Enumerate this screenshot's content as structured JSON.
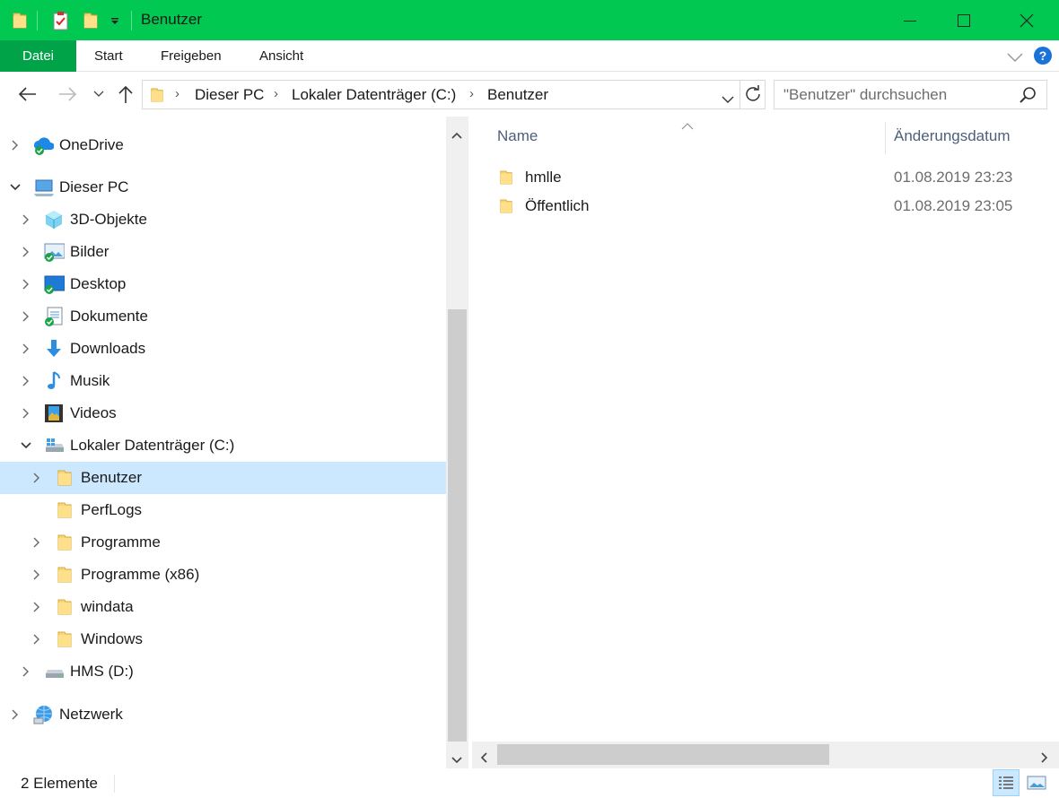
{
  "window": {
    "title": "Benutzer",
    "colors": {
      "titlebar": "#00c850",
      "file_tab": "#00a348",
      "selection": "#cce8ff",
      "help": "#1a73d9"
    }
  },
  "quick_access": {
    "icons": [
      "folder-icon",
      "properties-icon",
      "new-folder-icon",
      "customize-dropdown-icon"
    ]
  },
  "ribbon": {
    "tabs": [
      {
        "label": "Datei"
      },
      {
        "label": "Start"
      },
      {
        "label": "Freigeben"
      },
      {
        "label": "Ansicht"
      }
    ]
  },
  "address": {
    "breadcrumbs": [
      "Dieser PC",
      "Lokaler Datenträger (C:)",
      "Benutzer"
    ],
    "search_placeholder": "\"Benutzer\" durchsuchen"
  },
  "nav": {
    "items": [
      {
        "label": "OneDrive",
        "icon": "onedrive-icon",
        "expander": "collapsed"
      },
      {
        "label": "Dieser PC",
        "icon": "computer-icon",
        "expander": "expanded"
      },
      {
        "label": "3D-Objekte",
        "icon": "cube-icon",
        "expander": "collapsed"
      },
      {
        "label": "Bilder",
        "icon": "pictures-icon",
        "expander": "collapsed"
      },
      {
        "label": "Desktop",
        "icon": "desktop-icon",
        "expander": "collapsed"
      },
      {
        "label": "Dokumente",
        "icon": "documents-icon",
        "expander": "collapsed"
      },
      {
        "label": "Downloads",
        "icon": "download-icon",
        "expander": "collapsed"
      },
      {
        "label": "Musik",
        "icon": "music-icon",
        "expander": "collapsed"
      },
      {
        "label": "Videos",
        "icon": "videos-icon",
        "expander": "collapsed"
      },
      {
        "label": "Lokaler Datenträger (C:)",
        "icon": "drive-icon",
        "expander": "expanded"
      },
      {
        "label": "Benutzer",
        "icon": "folder-icon",
        "expander": "collapsed",
        "selected": true
      },
      {
        "label": "PerfLogs",
        "icon": "folder-icon",
        "expander": "none"
      },
      {
        "label": "Programme",
        "icon": "folder-icon",
        "expander": "collapsed"
      },
      {
        "label": "Programme (x86)",
        "icon": "folder-icon",
        "expander": "collapsed"
      },
      {
        "label": "windata",
        "icon": "folder-icon",
        "expander": "collapsed"
      },
      {
        "label": "Windows",
        "icon": "folder-icon",
        "expander": "collapsed"
      },
      {
        "label": "HMS (D:)",
        "icon": "drive-icon",
        "expander": "collapsed"
      },
      {
        "label": "Netzwerk",
        "icon": "network-icon",
        "expander": "collapsed"
      }
    ]
  },
  "content": {
    "columns": {
      "name": "Name",
      "date": "Änderungsdatum"
    },
    "sort": "name-ascending",
    "files": [
      {
        "name": "hmlle",
        "date": "01.08.2019 23:23",
        "icon": "folder-icon"
      },
      {
        "name": "Öffentlich",
        "date": "01.08.2019 23:05",
        "icon": "folder-icon"
      }
    ]
  },
  "status": {
    "count": "2 Elemente",
    "view_mode": "details"
  }
}
